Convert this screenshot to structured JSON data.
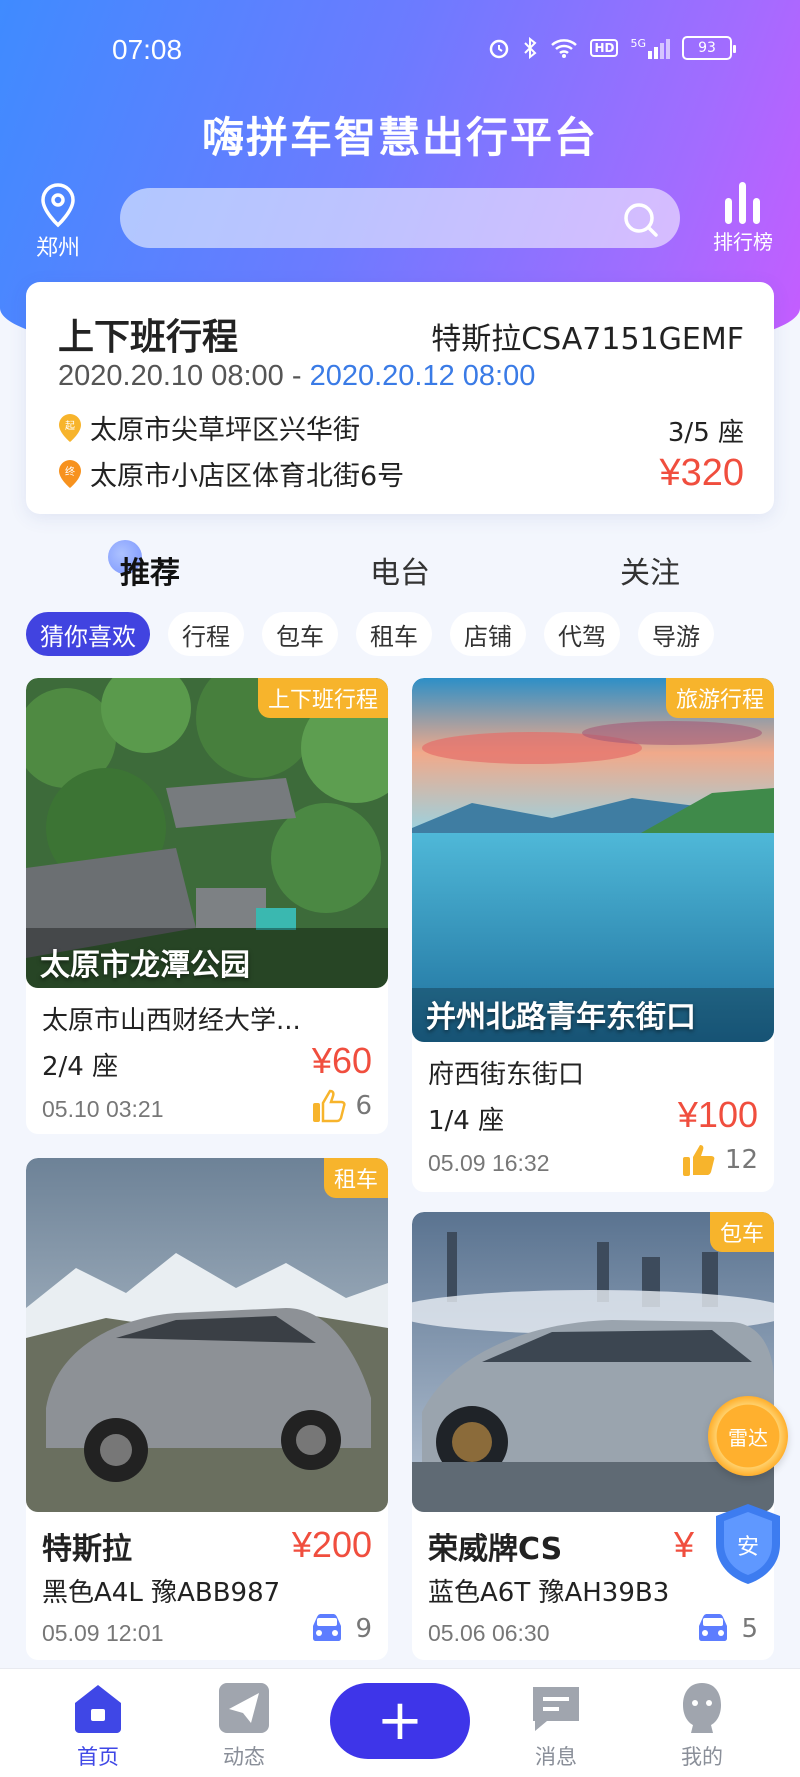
{
  "status_bar": {
    "time": "07:08",
    "battery": "93",
    "network": "5G",
    "hd": "HD"
  },
  "header": {
    "title": "嗨拼车智慧出行平台",
    "location": "郑州",
    "ranking": "排行榜"
  },
  "trip": {
    "title": "上下班行程",
    "plate": "特斯拉CSA7151GEMF",
    "time_start": "2020.20.10 08:00",
    "time_sep": " - ",
    "time_end": "2020.20.12 08:00",
    "start_badge": "起",
    "end_badge": "终",
    "start": "太原市尖草坪区兴华街",
    "end": "太原市小店区体育北街6号",
    "seats": "3/5 座",
    "price": "¥320"
  },
  "tabs": [
    "推荐",
    "电台",
    "关注"
  ],
  "chips": [
    "猜你喜欢",
    "行程",
    "包车",
    "租车",
    "店铺",
    "代驾",
    "导游"
  ],
  "cards": [
    {
      "tag": "上下班行程",
      "caption": "太原市龙潭公园",
      "line1": "太原市山西财经大学...",
      "line2": "2/4 座",
      "price": "¥60",
      "time": "05.10 03:21",
      "count": "6",
      "count_icon": "thumbs-up-icon"
    },
    {
      "tag": "旅游行程",
      "caption": "并州北路青年东街口",
      "line1": "府西街东街口",
      "line2": "1/4 座",
      "price": "¥100",
      "time": "05.09 16:32",
      "count": "12",
      "count_icon": "thumbs-up-icon"
    },
    {
      "tag": "租车",
      "caption": "",
      "line1": "特斯拉",
      "line2": "黑色A4L 豫ABB987",
      "price": "¥200",
      "time": "05.09 12:01",
      "count": "9",
      "count_icon": "car-icon"
    },
    {
      "tag": "包车",
      "caption": "",
      "line1": "荣威牌CS",
      "line2": "蓝色A6T 豫AH39B3",
      "price": "¥",
      "time": "05.06 06:30",
      "count": "5",
      "count_icon": "car-icon"
    }
  ],
  "floating": {
    "radar": "雷达",
    "safe": "安"
  },
  "bottom_nav": {
    "home": "首页",
    "feed": "动态",
    "add": "+",
    "messages": "消息",
    "mine": "我的"
  },
  "colors": {
    "accent": "#3e35e9",
    "price": "#f04e3e",
    "tag": "#f7b42c",
    "link_blue": "#3a7be6"
  }
}
